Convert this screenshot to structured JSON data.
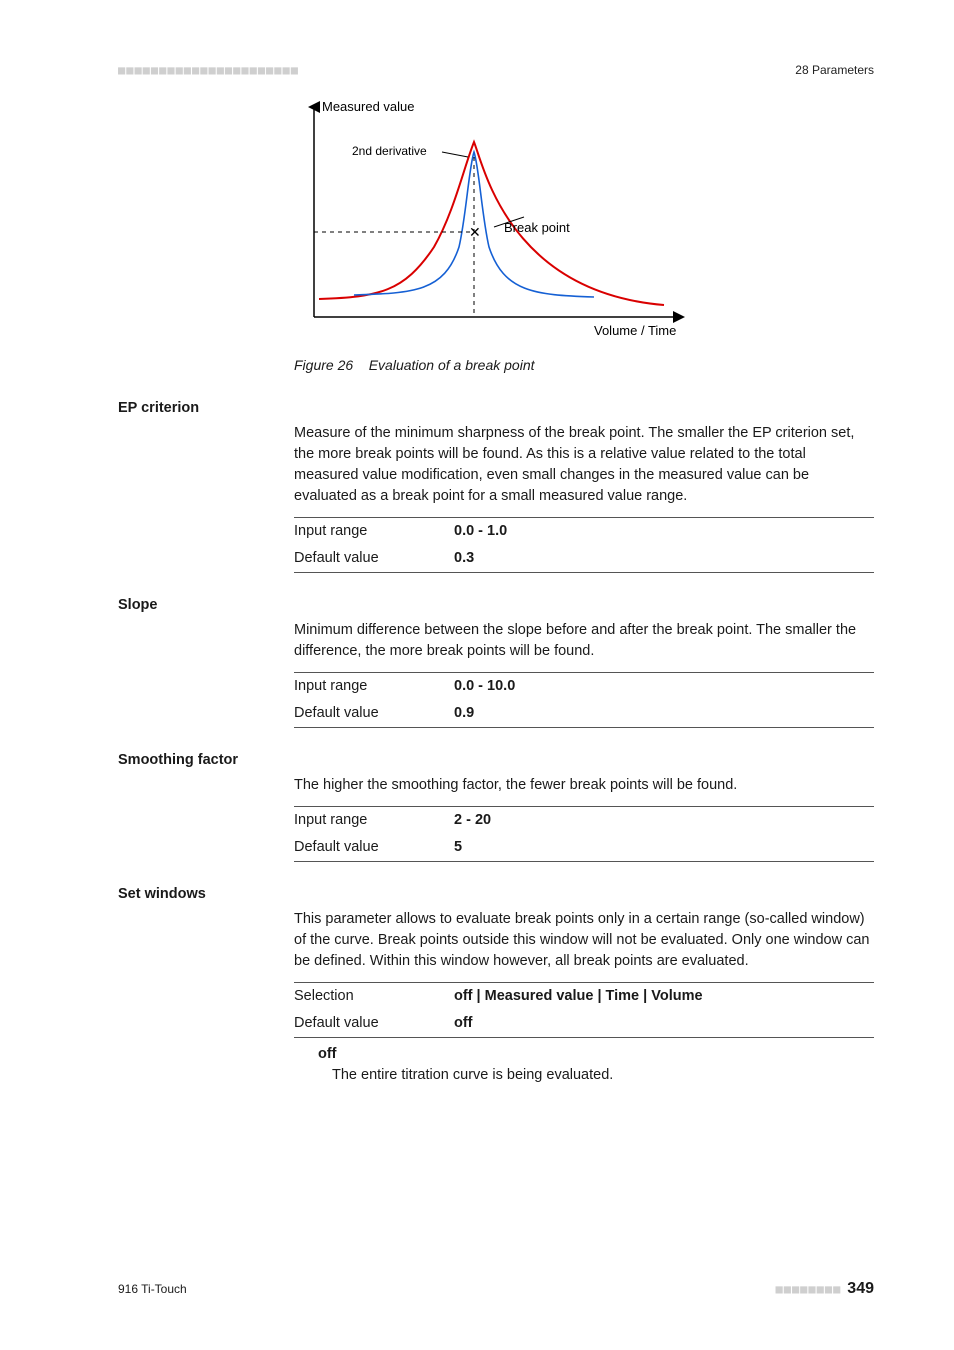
{
  "header": {
    "left_dots": "■■■■■■■■■■■■■■■■■■■■■■",
    "right": "28 Parameters"
  },
  "figure": {
    "y_label": "Measured value",
    "deriv_label": "2nd derivative",
    "break_label": "Break point",
    "x_label": "Volume / Time",
    "caption_prefix": "Figure 26",
    "caption_text": "Evaluation of a break point"
  },
  "sections": [
    {
      "heading": "EP criterion",
      "para": "Measure of the minimum sharpness of the break point. The smaller the EP criterion set, the more break points will be found. As this is a relative value related to the total measured value modification, even small changes in the measured value can be evaluated as a break point for a small measured value range.",
      "rows": [
        {
          "label": "Input range",
          "value": "0.0 - 1.0"
        },
        {
          "label": "Default value",
          "value": "0.3"
        }
      ]
    },
    {
      "heading": "Slope",
      "para": "Minimum difference between the slope before and after the break point. The smaller the difference, the more break points will be found.",
      "rows": [
        {
          "label": "Input range",
          "value": "0.0 - 10.0"
        },
        {
          "label": "Default value",
          "value": "0.9"
        }
      ]
    },
    {
      "heading": "Smoothing factor",
      "para": "The higher the smoothing factor, the fewer break points will be found.",
      "rows": [
        {
          "label": "Input range",
          "value": "2 - 20"
        },
        {
          "label": "Default value",
          "value": "5"
        }
      ]
    },
    {
      "heading": "Set windows",
      "para": "This parameter allows to evaluate break points only in a certain range (so-called window) of the curve. Break points outside this window will not be evaluated. Only one window can be defined. Within this window however, all break points are evaluated.",
      "rows": [
        {
          "label": "Selection",
          "value": "off | Measured value | Time | Volume"
        },
        {
          "label": "Default value",
          "value": "off"
        }
      ],
      "option": {
        "term": "off",
        "desc": "The entire titration curve is being evaluated."
      }
    }
  ],
  "footer": {
    "left": "916 Ti-Touch",
    "right_dots": "■■■■■■■■",
    "page": "349"
  }
}
